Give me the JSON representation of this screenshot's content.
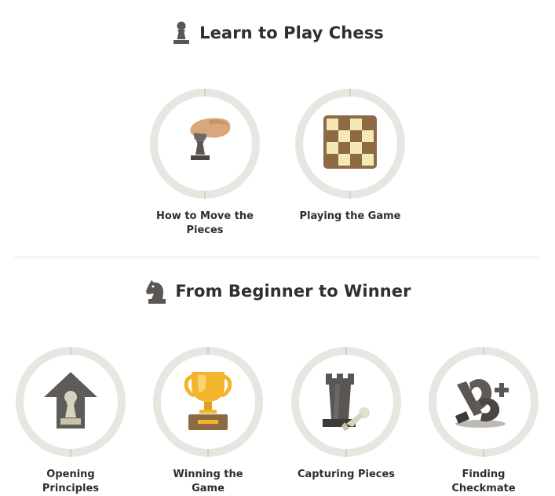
{
  "sections": [
    {
      "title": "Learn to Play Chess",
      "icon": "pawn-icon",
      "lessons": [
        {
          "label": "How to Move the Pieces",
          "icon": "hand-moving-pawn-icon"
        },
        {
          "label": "Playing the Game",
          "icon": "chessboard-icon"
        }
      ]
    },
    {
      "title": "From Beginner to Winner",
      "icon": "knight-icon",
      "lessons": [
        {
          "label": "Opening Principles",
          "icon": "pawn-up-arrow-icon"
        },
        {
          "label": "Winning the Game",
          "icon": "trophy-icon"
        },
        {
          "label": "Capturing Pieces",
          "icon": "rook-capturing-pawn-icon"
        },
        {
          "label": "Finding Checkmate",
          "icon": "fallen-king-icon"
        }
      ]
    }
  ],
  "colors": {
    "text": "#312e2b",
    "ring": "#e8e6e1",
    "divider": "#e6e4e1",
    "board_dark": "#8b6a44",
    "board_light": "#f6e8b6",
    "trophy_gold": "#f2b52d",
    "piece_gray": "#5a5654"
  }
}
